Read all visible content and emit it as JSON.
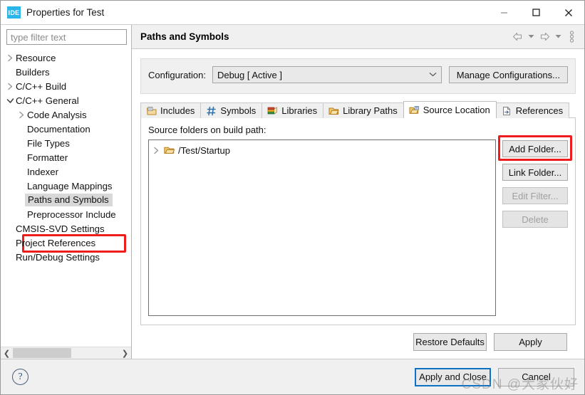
{
  "window": {
    "icon_label": "IDE",
    "title": "Properties for Test",
    "controls": {
      "minimize": "minimize",
      "maximize": "maximize",
      "close": "close"
    }
  },
  "sidebar": {
    "filter_placeholder": "type filter text",
    "filter_value": "",
    "items": [
      {
        "label": "Resource",
        "indent": 0,
        "twisty": "collapsed",
        "selected": false
      },
      {
        "label": "Builders",
        "indent": 0,
        "twisty": "none",
        "selected": false
      },
      {
        "label": "C/C++ Build",
        "indent": 0,
        "twisty": "collapsed",
        "selected": false
      },
      {
        "label": "C/C++ General",
        "indent": 0,
        "twisty": "expanded",
        "selected": false
      },
      {
        "label": "Code Analysis",
        "indent": 1,
        "twisty": "collapsed",
        "selected": false
      },
      {
        "label": "Documentation",
        "indent": 1,
        "twisty": "none",
        "selected": false
      },
      {
        "label": "File Types",
        "indent": 1,
        "twisty": "none",
        "selected": false
      },
      {
        "label": "Formatter",
        "indent": 1,
        "twisty": "none",
        "selected": false
      },
      {
        "label": "Indexer",
        "indent": 1,
        "twisty": "none",
        "selected": false
      },
      {
        "label": "Language Mappings",
        "indent": 1,
        "twisty": "none",
        "selected": false
      },
      {
        "label": "Paths and Symbols",
        "indent": 1,
        "twisty": "none",
        "selected": true
      },
      {
        "label": "Preprocessor Include",
        "indent": 1,
        "twisty": "none",
        "selected": false
      },
      {
        "label": "CMSIS-SVD Settings",
        "indent": 0,
        "twisty": "none",
        "selected": false
      },
      {
        "label": "Project References",
        "indent": 0,
        "twisty": "none",
        "selected": false
      },
      {
        "label": "Run/Debug Settings",
        "indent": 0,
        "twisty": "none",
        "selected": false
      }
    ],
    "scroll_left_arrow": "❮",
    "scroll_right_arrow": "❯"
  },
  "page": {
    "title": "Paths and Symbols",
    "toolbar": {
      "back": "back-arrow",
      "back_menu": "back-dropdown",
      "forward": "forward-arrow",
      "forward_menu": "forward-dropdown",
      "more": "view-menu"
    },
    "configuration": {
      "label": "Configuration:",
      "value": "Debug  [ Active ]",
      "manage_button": "Manage Configurations..."
    },
    "tabs": [
      {
        "label": "Includes",
        "icon": "includes-icon",
        "active": false
      },
      {
        "label": "Symbols",
        "icon": "symbols-hash-icon",
        "active": false
      },
      {
        "label": "Libraries",
        "icon": "libraries-icon",
        "active": false
      },
      {
        "label": "Library Paths",
        "icon": "library-paths-icon",
        "active": false
      },
      {
        "label": "Source Location",
        "icon": "source-location-icon",
        "active": true
      },
      {
        "label": "References",
        "icon": "references-icon",
        "active": false
      }
    ],
    "source_location": {
      "label": "Source folders on build path:",
      "entries": [
        {
          "path": "/Test/Startup",
          "icon": "folder-icon",
          "twisty": "collapsed"
        }
      ],
      "buttons": [
        {
          "label": "Add Folder...",
          "enabled": true,
          "highlighted": true
        },
        {
          "label": "Link Folder...",
          "enabled": true,
          "highlighted": false
        },
        {
          "label": "Edit Filter...",
          "enabled": false,
          "highlighted": false
        },
        {
          "label": "Delete",
          "enabled": false,
          "highlighted": false
        }
      ]
    },
    "apply_row": {
      "restore_defaults": "Restore Defaults",
      "apply": "Apply"
    }
  },
  "footer": {
    "help": "?",
    "apply_and_close": "Apply and Close",
    "cancel": "Cancel"
  },
  "watermark": "CSDN @大家伙好",
  "colors": {
    "accent_blue": "#0a73c8",
    "highlight_red": "#ee1c1c",
    "ide_icon_bg": "#29b6e8",
    "panel_grey": "#f0f0f0",
    "selection_grey": "#d8d8d8"
  }
}
